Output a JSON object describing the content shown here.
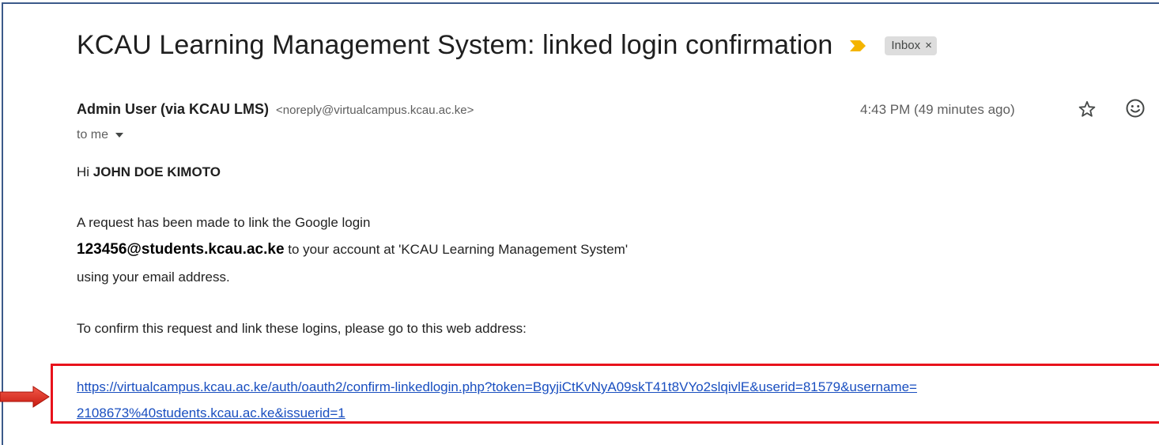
{
  "email": {
    "subject": "KCAU Learning Management System: linked login confirmation",
    "label": "Inbox",
    "label_close": "×",
    "sender_name": "Admin User (via KCAU LMS)",
    "sender_email": "<noreply@virtualcampus.kcau.ac.ke>",
    "time": "4:43 PM (49 minutes ago)",
    "recipient": "to me",
    "greeting_prefix": "Hi ",
    "greeting_name": "JOHN DOE KIMOTO",
    "para1_line1": "A request has been made to link the Google login",
    "para1_email": "123456@students.kcau.ac.ke",
    "para1_line2_rest": " to your account at 'KCAU Learning Management System'",
    "para1_line3": "using your email address.",
    "para2": "To confirm this request and link these logins, please go to this web address:",
    "link_line1": "https://virtualcampus.kcau.ac.ke/auth/oauth2/confirm-linkedlogin.php?token=BgyjiCtKvNyA09skT41t8VYo2slqivlE&userid=81579&username=",
    "link_line2": "2108673%40students.kcau.ac.ke&issuerid=1"
  },
  "icons": {
    "importance": "importance-marker-icon",
    "star": "star-icon",
    "emoji": "emoji-reaction-icon",
    "recipient_dropdown": "chevron-down-icon",
    "callout": "arrow-right-icon"
  },
  "colors": {
    "importance": "#f4b400",
    "highlight_border": "#e8121c",
    "link": "#1a4fc0",
    "chip_bg": "#dddddd"
  }
}
